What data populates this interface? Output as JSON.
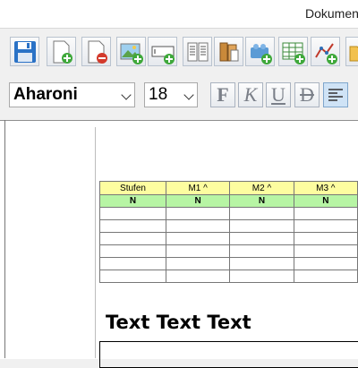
{
  "window": {
    "title": "Dokumen"
  },
  "toolbar": {
    "buttons": [
      {
        "name": "save-button",
        "icon": "floppy-disk-icon"
      },
      {
        "name": "new-page-button",
        "icon": "page-add-icon"
      },
      {
        "name": "remove-page-button",
        "icon": "page-remove-icon"
      },
      {
        "name": "add-image-button",
        "icon": "image-add-icon"
      },
      {
        "name": "add-textfield-button",
        "icon": "textfield-add-icon"
      },
      {
        "name": "add-text-columns-button",
        "icon": "text-columns-icon"
      },
      {
        "name": "add-bookshelf-button",
        "icon": "books-icon"
      },
      {
        "name": "add-blocks-button",
        "icon": "lego-block-add-icon"
      },
      {
        "name": "add-table-button",
        "icon": "table-add-icon"
      },
      {
        "name": "add-chart-button",
        "icon": "chart-add-icon"
      },
      {
        "name": "open-folder-button",
        "icon": "folder-icon"
      }
    ]
  },
  "format": {
    "font_name": "Aharoni",
    "font_size": "18",
    "bold_label": "F",
    "italic_label": "K",
    "underline_label": "U",
    "strike_label": "D",
    "align_left_active": true
  },
  "document": {
    "table": {
      "headers": [
        "Stufen",
        "M1 ^",
        "M2 ^",
        "M3 ^"
      ],
      "subheaders": [
        "N",
        "N",
        "N",
        "N"
      ],
      "header_color": "#fdfda0",
      "subheader_color": "#b7f5a4",
      "empty_rows": 6
    },
    "heading": "Text Text Text"
  }
}
